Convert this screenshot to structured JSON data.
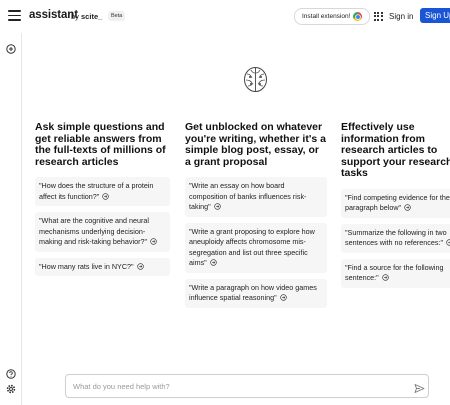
{
  "header": {
    "brand": "assistant",
    "by_prefix": "by ",
    "by_name": "scite_",
    "beta": "Beta",
    "install_label": "Install extension!",
    "signin_label": "Sign in",
    "signup_label": "Sign Up"
  },
  "rail": {
    "icons": [
      "plus-circle-icon",
      "help-circle-icon",
      "gear-icon"
    ]
  },
  "columns": [
    {
      "title": "Ask simple questions and get reliable answers from the full-texts of millions of research articles",
      "cards": [
        "\"How does the structure of a protein affect its function?\"",
        "\"What are the cognitive and neural mechanisms underlying decision-making and risk-taking behavior?\"",
        "\"How many rats live in NYC?\""
      ]
    },
    {
      "title": "Get unblocked on whatever you're writing, whether it's a simple blog post, essay, or a grant proposal",
      "cards": [
        "\"Write an essay on how board composition of banks influences risk-taking\"",
        "\"Write a grant proposing to explore how aneuploidy affects chromosome mis-segregation and list out three specific aims\"",
        "\"Write a paragraph on how video games influence spatial reasoning\""
      ]
    },
    {
      "title": "Effectively use information from research articles to support your research tasks",
      "cards": [
        "\"Find competing evidence for the paragraph below\"",
        "\"Summarize the following in two sentences with no references:\"",
        "\"Find a source for the following sentence:\""
      ]
    }
  ],
  "input": {
    "placeholder": "What do you need help with?"
  },
  "colors": {
    "accent": "#1a55d6",
    "card_bg": "#f6f6f6"
  }
}
